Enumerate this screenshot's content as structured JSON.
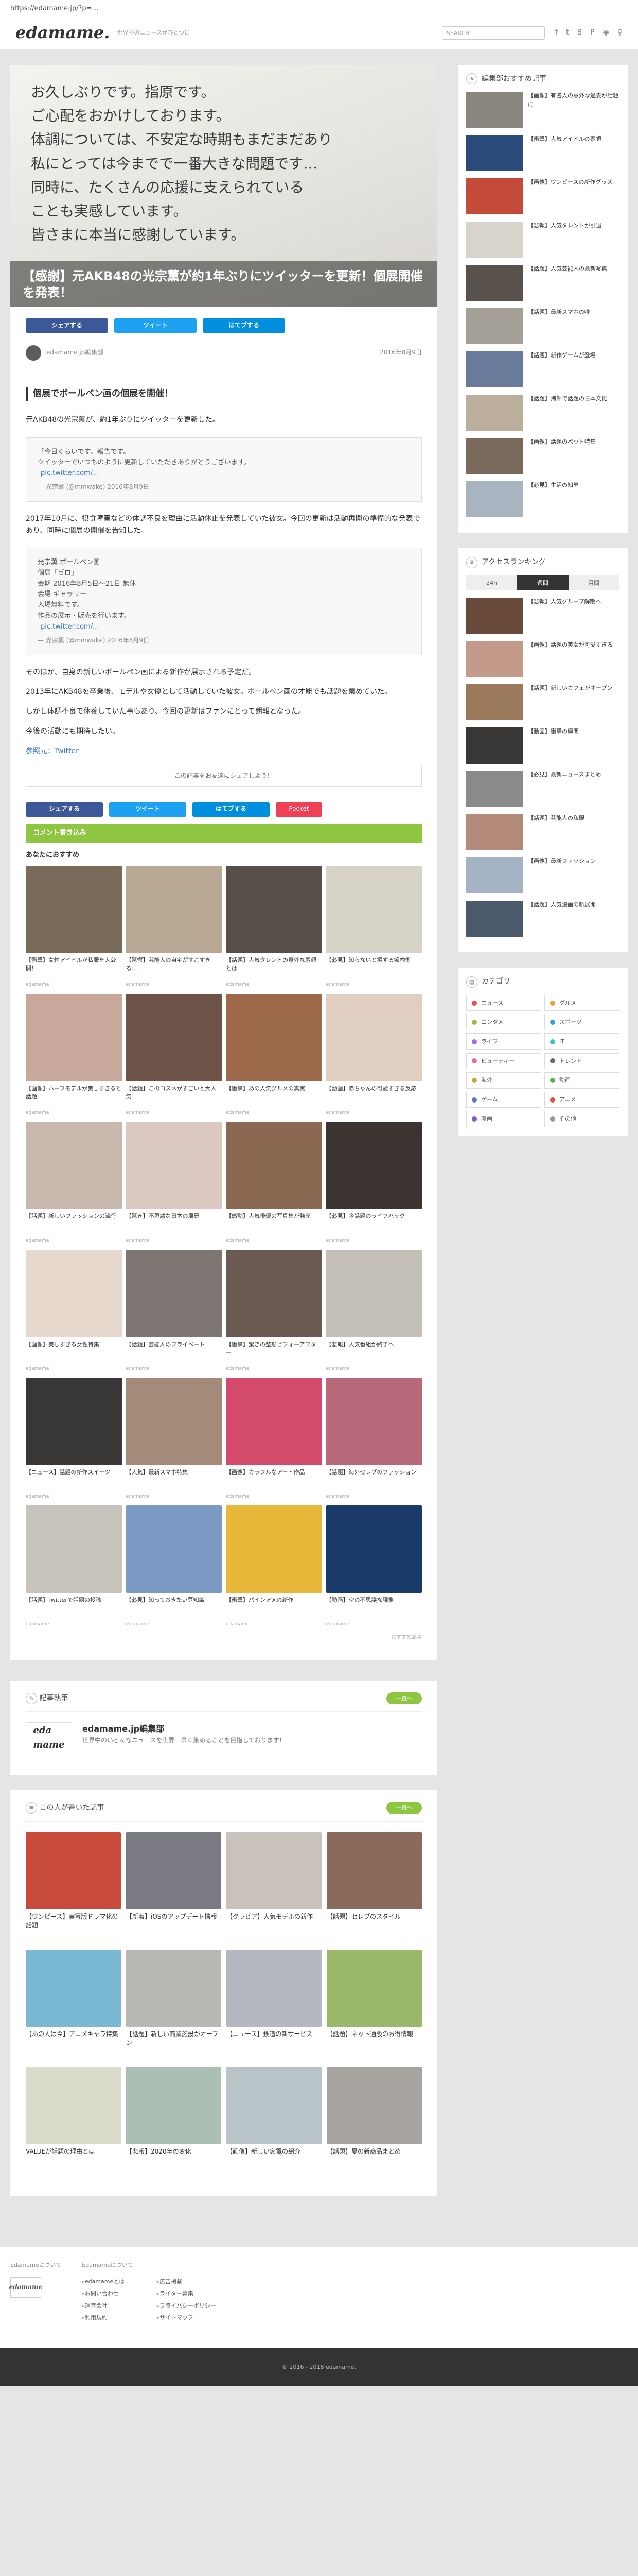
{
  "url": "https://edamame.jp/?p=…",
  "site": {
    "logo": "edamame.",
    "tagline": "世界中のニュースがひとつに",
    "search_placeholder": "SEARCH"
  },
  "article": {
    "hero_text": "お久しぶりです。指原です。\nご心配をおかけしております。\n体調については、不安定な時期もまだまだあり\n私にとっては今までで一番大きな問題です…\n同時に、たくさんの応援に支えられている\nことも実感しています。\n皆さまに本当に感謝しています。",
    "title": "【感謝】元AKB48の光宗薫が約1年ぶりにツイッターを更新！個展開催を発表！",
    "share": {
      "facebook": "シェアする",
      "twitter": "ツイート",
      "hatena": "はてブする"
    },
    "author": "edamame.jp編集部",
    "date": "2016年8月9日",
    "heading": "個展でボールペン画の個展を開催！",
    "intro": "元AKB48の光宗薫が、約1年ぶりにツイッターを更新した。",
    "tweet1": {
      "text": "「今日ぐらいです、報告です。\nツイッターでいつものように更新していただきありがとうございます。",
      "link": "pic.twitter.com/...",
      "by": "— 光宗薫 (@mmwake) 2016年8月9日"
    },
    "para2": "2017年10月に、摂食障害などの体調不良を理由に活動休止を発表していた彼女。今回の更新は活動再開の準備的な発表であり、同時に個展の開催を告知した。",
    "tweet2": {
      "text": "光宗薫 ボールペン画\n個展「ゼロ」\n会期 2016年8月5日〜21日 無休\n会場 ギャラリー\n入場無料です。\n作品の展示・販売を行います。",
      "link": "pic.twitter.com/...",
      "by": "— 光宗薫 (@mmwake) 2016年8月9日"
    },
    "para3": "そのほか、自身の新しいボールペン画による新作が展示される予定だ。",
    "para4": "2013年にAKB48を卒業後、モデルや女優として活動していた彼女。ボールペン画の才能でも話題を集めていた。",
    "para5": "しかし体調不良で休養していた事もあり、今回の更新はファンにとって朗報となった。",
    "para6": "今後の活動にも期待したい。",
    "source": "参照元：Twitter",
    "like_text": "この記事をお友達にシェアしよう！",
    "pocket": "Pocket",
    "comments_label": "コメント書き込み",
    "rec_title": "あなたにおすすめ",
    "ad_note": "おすすめ記事",
    "rec": [
      {
        "title": "【衝撃】女性アイドルが私服を大公開！",
        "src": "edamame",
        "color": "#7a6a5a"
      },
      {
        "title": "【驚愕】芸能人の自宅がすごすぎる…",
        "src": "edamame",
        "color": "#b8a894"
      },
      {
        "title": "【話題】人気タレントの意外な素顔とは",
        "src": "edamame",
        "color": "#585048"
      },
      {
        "title": "【必見】知らないと損する節約術",
        "src": "edamame",
        "color": "#d7d2c8"
      },
      {
        "title": "【画像】ハーフモデルが美しすぎると話題",
        "src": "edamame",
        "color": "#c7a89a"
      },
      {
        "title": "【話題】このコスメがすごいと大人気",
        "src": "edamame",
        "color": "#6e5448"
      },
      {
        "title": "【衝撃】あの人気グルメの真実",
        "src": "edamame",
        "color": "#9c6a4a"
      },
      {
        "title": "【動画】赤ちゃんの可愛すぎる反応",
        "src": "edamame",
        "color": "#e0cfc0"
      },
      {
        "title": "【話題】新しいファッションの流行",
        "src": "edamame",
        "color": "#c9b8ae"
      },
      {
        "title": "【驚き】不思議な日本の風景",
        "src": "edamame",
        "color": "#dbc8c0"
      },
      {
        "title": "【感動】人気俳優の写真集が発売",
        "src": "edamame",
        "color": "#8a6852"
      },
      {
        "title": "【必見】今話題のライフハック",
        "src": "edamame",
        "color": "#3b3430"
      },
      {
        "title": "【画像】美しすぎる女性特集",
        "src": "edamame",
        "color": "#e7d8ce"
      },
      {
        "title": "【話題】芸能人のプライベート",
        "src": "edamame",
        "color": "#7d7672"
      },
      {
        "title": "【衝撃】驚きの整形ビフォーアフター",
        "src": "edamame",
        "color": "#6a5a52"
      },
      {
        "title": "【悲報】人気番組が終了へ",
        "src": "edamame",
        "color": "#c4c0b8"
      },
      {
        "title": "【ニュース】話題の新作スイーツ",
        "src": "edamame",
        "color": "#3a3836"
      },
      {
        "title": "【人気】最新スマホ特集",
        "src": "edamame",
        "color": "#a48a78"
      },
      {
        "title": "【画像】カラフルなアート作品",
        "src": "edamame",
        "color": "#d34a6a"
      },
      {
        "title": "【話題】海外セレブのファッション",
        "src": "edamame",
        "color": "#b86a7a"
      },
      {
        "title": "【話題】Twitterで話題の投稿",
        "src": "edamame",
        "color": "#c8c4bc"
      },
      {
        "title": "【必見】知っておきたい豆知識",
        "src": "edamame",
        "color": "#7a9ac4"
      },
      {
        "title": "【衝撃】パインアメの新作",
        "src": "edamame",
        "color": "#e8b83a"
      },
      {
        "title": "【動画】空の不思議な現象",
        "src": "edamame",
        "color": "#1a3a6a"
      }
    ]
  },
  "writer": {
    "section": "記事執筆",
    "pill": "一覧へ",
    "name": "edamame.jp編集部",
    "desc": "世界中のいろんなニュースを世界一早く集めることを目指しております！"
  },
  "related": {
    "section": "この人が書いた記事",
    "pill": "一覧へ",
    "items": [
      {
        "title": "【ワンピース】実写版ドラマ化の話題",
        "color": "#c84a3a"
      },
      {
        "title": "【新着】iOSのアップデート情報",
        "color": "#7a7a82"
      },
      {
        "title": "【グラビア】人気モデルの新作",
        "color": "#c8c2ba"
      },
      {
        "title": "【話題】セレブのスタイル",
        "color": "#8a6a5a"
      },
      {
        "title": "【あの人は今】アニメキャラ特集",
        "color": "#7ab8d4"
      },
      {
        "title": "【話題】新しい商業施設がオープン",
        "color": "#b8b8b4"
      },
      {
        "title": "【ニュース】鉄道の新サービス",
        "color": "#b4b8c0"
      },
      {
        "title": "【話題】ネット通販のお得情報",
        "color": "#9ab86a"
      },
      {
        "title": "VALUEが話題の理由とは",
        "color": "#d8dcc8"
      },
      {
        "title": "【悲報】2020年の変化",
        "color": "#aac0b4"
      },
      {
        "title": "【画像】新しい家電の紹介",
        "color": "#b8c4c8"
      },
      {
        "title": "【話題】夏の新商品まとめ",
        "color": "#a8a4a0"
      }
    ]
  },
  "sidebar": {
    "rec_title": "編集部おすすめ記事",
    "rec": [
      {
        "title": "【画像】有名人の意外な過去が話題に",
        "color": "#8a8680"
      },
      {
        "title": "【衝撃】人気アイドルの素顔",
        "color": "#2a4a7a"
      },
      {
        "title": "【画像】ワンピースの新作グッズ",
        "color": "#c44a3a"
      },
      {
        "title": "【悲報】人気タレントが引退",
        "color": "#d8d4cc"
      },
      {
        "title": "【話題】人気芸能人の最新写真",
        "color": "#5a524c"
      },
      {
        "title": "【話題】最新スマホの噂",
        "color": "#a4a098"
      },
      {
        "title": "【話題】新作ゲームが登場",
        "color": "#6a7a9a"
      },
      {
        "title": "【話題】海外で話題の日本文化",
        "color": "#bcae9c"
      },
      {
        "title": "【画像】話題のペット特集",
        "color": "#7a6a5c"
      },
      {
        "title": "【必見】生活の知恵",
        "color": "#a8b4c0"
      }
    ],
    "rank_title": "アクセスランキング",
    "rank_tabs": [
      "24h",
      "週間",
      "月間"
    ],
    "rank": [
      {
        "title": "【悲報】人気グループ解散へ",
        "color": "#6a4a3a"
      },
      {
        "title": "【画像】話題の美女が可愛すぎる",
        "color": "#c49a8a"
      },
      {
        "title": "【話題】新しいカフェがオープン",
        "color": "#9a7a5a"
      },
      {
        "title": "【動画】衝撃の瞬間",
        "color": "#3a3836"
      },
      {
        "title": "【必見】最新ニュースまとめ",
        "color": "#8a8a8a"
      },
      {
        "title": "【話題】芸能人の私服",
        "color": "#b48a7a"
      },
      {
        "title": "【画像】最新ファッション",
        "color": "#a4b4c4"
      },
      {
        "title": "【話題】人気漫画の新展開",
        "color": "#4a5a6a"
      }
    ],
    "cat_title": "カテゴリ",
    "cats": [
      {
        "name": "ニュース",
        "color": "#e84a5a"
      },
      {
        "name": "グルメ",
        "color": "#e8a03a"
      },
      {
        "name": "エンタメ",
        "color": "#8ec641"
      },
      {
        "name": "スポーツ",
        "color": "#3a9ae8"
      },
      {
        "name": "ライフ",
        "color": "#a86ae8"
      },
      {
        "name": "IT",
        "color": "#3ac8b8"
      },
      {
        "name": "ビューティー",
        "color": "#e86aa8"
      },
      {
        "name": "トレンド",
        "color": "#6a6a6a"
      },
      {
        "name": "海外",
        "color": "#c8a83a"
      },
      {
        "name": "動画",
        "color": "#4ab84a"
      },
      {
        "name": "ゲーム",
        "color": "#5a7ac8"
      },
      {
        "name": "アニメ",
        "color": "#d45a3a"
      },
      {
        "name": "漫画",
        "color": "#8a5ac8"
      },
      {
        "name": "その他",
        "color": "#999999"
      }
    ]
  },
  "footer": {
    "col1_title": "Edamameについて",
    "col1": [
      "edamameとは",
      "広告掲載",
      "お問い合わせ",
      "ライター募集"
    ],
    "col2_title": "Edamameについて",
    "col2": [
      "運営会社",
      "プライバシーポリシー",
      "利用規約",
      "サイトマップ"
    ],
    "logo": "edamame",
    "copyright": "© 2016 - 2018 edamame."
  }
}
